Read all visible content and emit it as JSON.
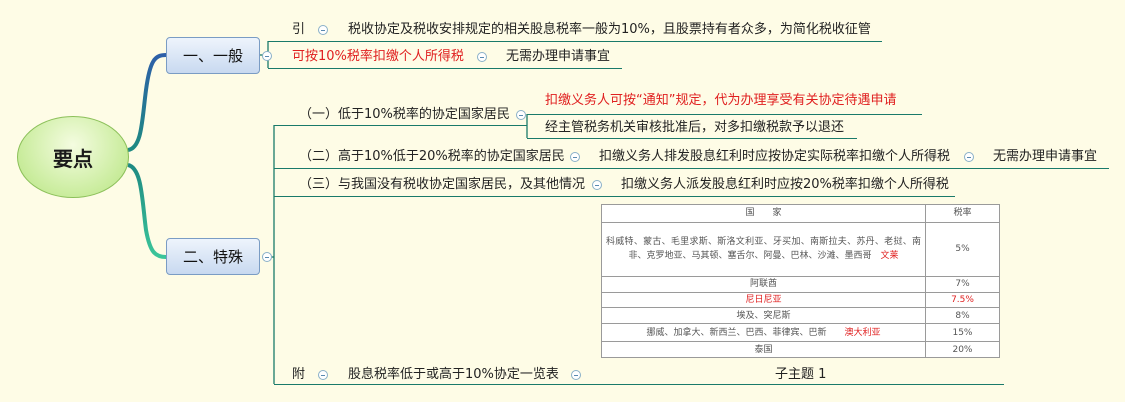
{
  "root": {
    "label": "要点"
  },
  "general": {
    "label": "一、一般",
    "intro_tag": "引",
    "intro_text": "税收协定及税收安排规定的相关股息税率一般为10%，且股票持有者众多，为简化税收征管",
    "withhold_text": "可按10%税率扣缴个人所得税",
    "no_apply_text": "无需办理申请事宜"
  },
  "special": {
    "label": "二、特殊",
    "item1": {
      "label": "（一）低于10%税率的协定国家居民",
      "sub1": "扣缴义务人可按“通知”规定，代为办理享受有关协定待遇申请",
      "sub2": "经主管税务机关审核批准后，对多扣缴税款予以退还"
    },
    "item2": {
      "label": "（二）高于10%低于20%税率的协定国家居民",
      "sub1": "扣缴义务人排发股息红利时应按协定实际税率扣缴个人所得税",
      "sub2": "无需办理申请事宜"
    },
    "item3": {
      "label": "（三）与我国没有税收协定国家居民，及其他情况",
      "sub1": "扣缴义务人派发股息红利时应按20%税率扣缴个人所得税"
    },
    "appendix": {
      "tag": "附",
      "label": "股息税率低于或高于10%协定一览表",
      "child": "子主题 1"
    }
  },
  "table": {
    "header_country": "国　　家",
    "header_rate": "税率",
    "rows": [
      {
        "country": "科威特、蒙古、毛里求斯、斯洛文利亚、牙买加、南斯拉夫、苏丹、老挝、南非、克罗地亚、马其顿、塞舌尔、阿曼、巴林、沙滩、墨西哥",
        "country_red": "文莱",
        "rate": "5%"
      },
      {
        "country": "阿联酋",
        "country_red": "",
        "rate": "7%"
      },
      {
        "country": "尼日尼亚",
        "country_red": "",
        "rate": "7.5%",
        "red": true
      },
      {
        "country": "埃及、突尼斯",
        "country_red": "",
        "rate": "8%"
      },
      {
        "country": "挪威、加拿大、新西兰、巴西、菲律宾、巴新",
        "country_red": "澳大利亚",
        "rate": "15%"
      },
      {
        "country": "泰国",
        "country_red": "",
        "rate": "20%"
      }
    ]
  },
  "colors": {
    "background": "#fefce6",
    "connector": "#1a7a6a",
    "highlight": "#e02020",
    "root_fill": "#c9ec9c"
  }
}
